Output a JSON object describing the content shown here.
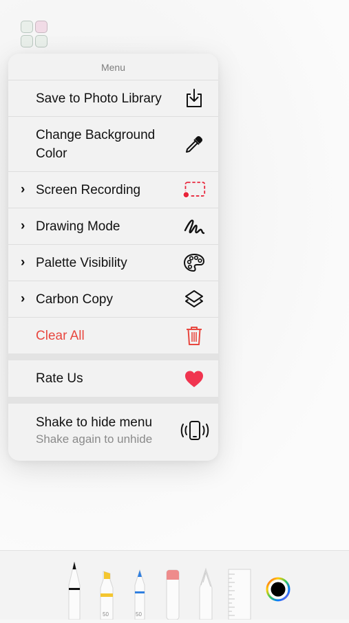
{
  "menu": {
    "title": "Menu",
    "items": [
      {
        "label": "Save to Photo Library",
        "icon": "save-download-icon",
        "submenu": false
      },
      {
        "label": "Change Background Color",
        "icon": "eyedropper-icon",
        "submenu": false
      },
      {
        "label": "Screen Recording",
        "icon": "screen-recording-icon",
        "submenu": true
      },
      {
        "label": "Drawing Mode",
        "icon": "scribble-icon",
        "submenu": true
      },
      {
        "label": "Palette Visibility",
        "icon": "palette-icon",
        "submenu": true
      },
      {
        "label": "Carbon Copy",
        "icon": "layers-icon",
        "submenu": true
      },
      {
        "label": "Clear All",
        "icon": "trash-icon",
        "submenu": false,
        "destructive": true
      },
      {
        "label": "Rate Us",
        "icon": "heart-icon",
        "submenu": false
      },
      {
        "label": "Shake to hide menu",
        "sublabel": "Shake again to unhide",
        "icon": "shake-phone-icon",
        "submenu": false
      }
    ],
    "chevron": "›"
  },
  "toolbar": {
    "tools": [
      {
        "name": "pen",
        "number": ""
      },
      {
        "name": "highlighter",
        "number": "50"
      },
      {
        "name": "marker",
        "number": "50"
      },
      {
        "name": "eraser",
        "number": ""
      },
      {
        "name": "lasso",
        "number": ""
      },
      {
        "name": "ruler",
        "number": ""
      }
    ],
    "current_color": "#000000"
  },
  "colors": {
    "accent_red": "#e8473f",
    "heart_red": "#f0344f",
    "recording_red": "#e8243a"
  }
}
